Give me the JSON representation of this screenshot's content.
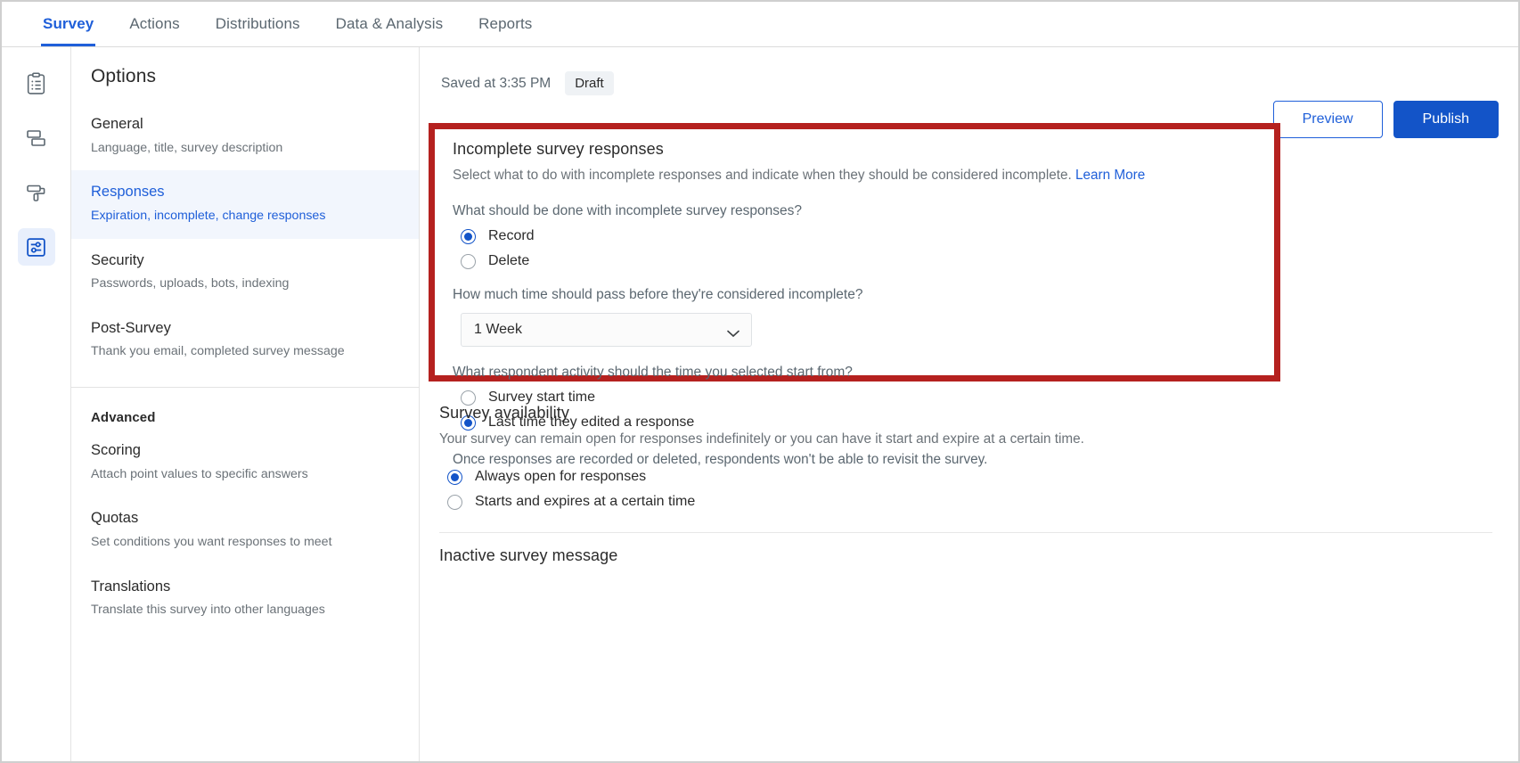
{
  "topnav": {
    "tabs": [
      {
        "label": "Survey",
        "active": true
      },
      {
        "label": "Actions",
        "active": false
      },
      {
        "label": "Distributions",
        "active": false
      },
      {
        "label": "Data & Analysis",
        "active": false
      },
      {
        "label": "Reports",
        "active": false
      }
    ]
  },
  "rail": {
    "items": [
      {
        "icon": "clipboard-survey-icon",
        "active": false
      },
      {
        "icon": "survey-flow-icon",
        "active": false
      },
      {
        "icon": "paint-roller-look-feel-icon",
        "active": false
      },
      {
        "icon": "sliders-options-icon",
        "active": true
      }
    ]
  },
  "sidebar": {
    "title": "Options",
    "items": [
      {
        "name": "General",
        "desc": "Language, title, survey description",
        "active": false
      },
      {
        "name": "Responses",
        "desc": "Expiration, incomplete, change responses",
        "active": true
      },
      {
        "name": "Security",
        "desc": "Passwords, uploads, bots, indexing",
        "active": false
      },
      {
        "name": "Post-Survey",
        "desc": "Thank you email, completed survey message",
        "active": false
      }
    ],
    "advanced_heading": "Advanced",
    "advanced_items": [
      {
        "name": "Scoring",
        "desc": "Attach point values to specific answers",
        "active": false
      },
      {
        "name": "Quotas",
        "desc": "Set conditions you want responses to meet",
        "active": false
      },
      {
        "name": "Translations",
        "desc": "Translate this survey into other languages",
        "active": false
      }
    ]
  },
  "statusbar": {
    "saved_text": "Saved at 3:35 PM",
    "badge": "Draft",
    "preview_label": "Preview",
    "publish_label": "Publish"
  },
  "incomplete": {
    "title": "Incomplete survey responses",
    "description": "Select what to do with incomplete responses and indicate when they should be considered incomplete.",
    "learn_more": "Learn More",
    "question1": "What should be done with incomplete survey responses?",
    "options1": [
      {
        "label": "Record",
        "checked": true
      },
      {
        "label": "Delete",
        "checked": false
      }
    ],
    "question2": "How much time should pass before they're considered incomplete?",
    "select_value": "1 Week",
    "question3": "What respondent activity should the time you selected start from?",
    "options3": [
      {
        "label": "Survey start time",
        "checked": false
      },
      {
        "label": "Last time they edited a response",
        "checked": true
      }
    ],
    "note": "Once responses are recorded or deleted, respondents won't be able to revisit the survey."
  },
  "availability": {
    "title": "Survey availability",
    "description": "Your survey can remain open for responses indefinitely or you can have it start and expire at a certain time.",
    "options": [
      {
        "label": "Always open for responses",
        "checked": true
      },
      {
        "label": "Starts and expires at a certain time",
        "checked": false
      }
    ]
  },
  "inactive_message": {
    "title": "Inactive survey message"
  },
  "colors": {
    "accent": "#1f5fd9",
    "primary_button": "#1354c8",
    "highlight_border": "#b5211f",
    "active_row_bg": "#f2f6fd"
  }
}
